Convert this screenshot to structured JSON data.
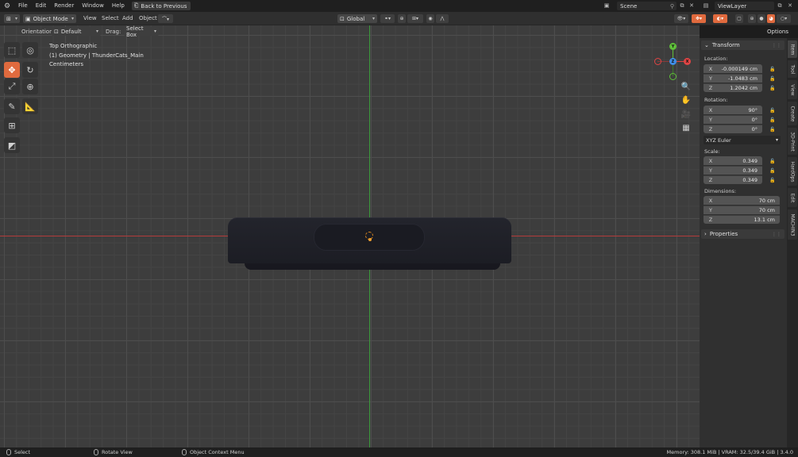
{
  "topbar": {
    "menu": [
      "File",
      "Edit",
      "Render",
      "Window",
      "Help"
    ],
    "back_button": "Back to Previous",
    "scene": "Scene",
    "view_layer": "ViewLayer"
  },
  "header": {
    "mode": "Object Mode",
    "menus": [
      "View",
      "Select",
      "Add",
      "Object"
    ],
    "transform_orientation": "Global",
    "options": "Options"
  },
  "subheader": {
    "orientation_label": "Orientation:",
    "orientation_value": "Default",
    "drag_label": "Drag:",
    "drag_value": "Select Box"
  },
  "viewport_overlay": {
    "view_name": "Top Orthographic",
    "collection": "(1) Geometry | ThunderCats_Main",
    "units": "Centimeters"
  },
  "gizmo": {
    "x": "X",
    "y": "Y",
    "z": "Z"
  },
  "npanel": {
    "transform_title": "Transform",
    "location_label": "Location:",
    "location": [
      {
        "axis": "X",
        "value": "-0.000149 cm"
      },
      {
        "axis": "Y",
        "value": "-1.0483 cm"
      },
      {
        "axis": "Z",
        "value": "1.2042 cm"
      }
    ],
    "rotation_label": "Rotation:",
    "rotation": [
      {
        "axis": "X",
        "value": "90°"
      },
      {
        "axis": "Y",
        "value": "0°"
      },
      {
        "axis": "Z",
        "value": "0°"
      }
    ],
    "rotation_mode": "XYZ Euler",
    "scale_label": "Scale:",
    "scale": [
      {
        "axis": "X",
        "value": "0.349"
      },
      {
        "axis": "Y",
        "value": "0.349"
      },
      {
        "axis": "Z",
        "value": "0.349"
      }
    ],
    "dimensions_label": "Dimensions:",
    "dimensions": [
      {
        "axis": "X",
        "value": "70 cm"
      },
      {
        "axis": "Y",
        "value": "70 cm"
      },
      {
        "axis": "Z",
        "value": "13.1 cm"
      }
    ],
    "properties_title": "Properties"
  },
  "side_tabs": [
    "Item",
    "Tool",
    "View",
    "Create",
    "3D-Print",
    "HardOps",
    "Edit",
    "MACHIN3"
  ],
  "statusbar": {
    "select": "Select",
    "rotate_view": "Rotate View",
    "context_menu": "Object Context Menu",
    "memory": "Memory: 308.1 MiB | VRAM: 32.5/39.4 GiB | 3.4.0"
  },
  "colors": {
    "accent": "#e06a3e",
    "axis_x": "#b33b3b",
    "axis_y": "#3c9a3c",
    "gizmo_x": "#e04444",
    "gizmo_y": "#5fbf3a",
    "gizmo_z": "#3f8ee8"
  }
}
